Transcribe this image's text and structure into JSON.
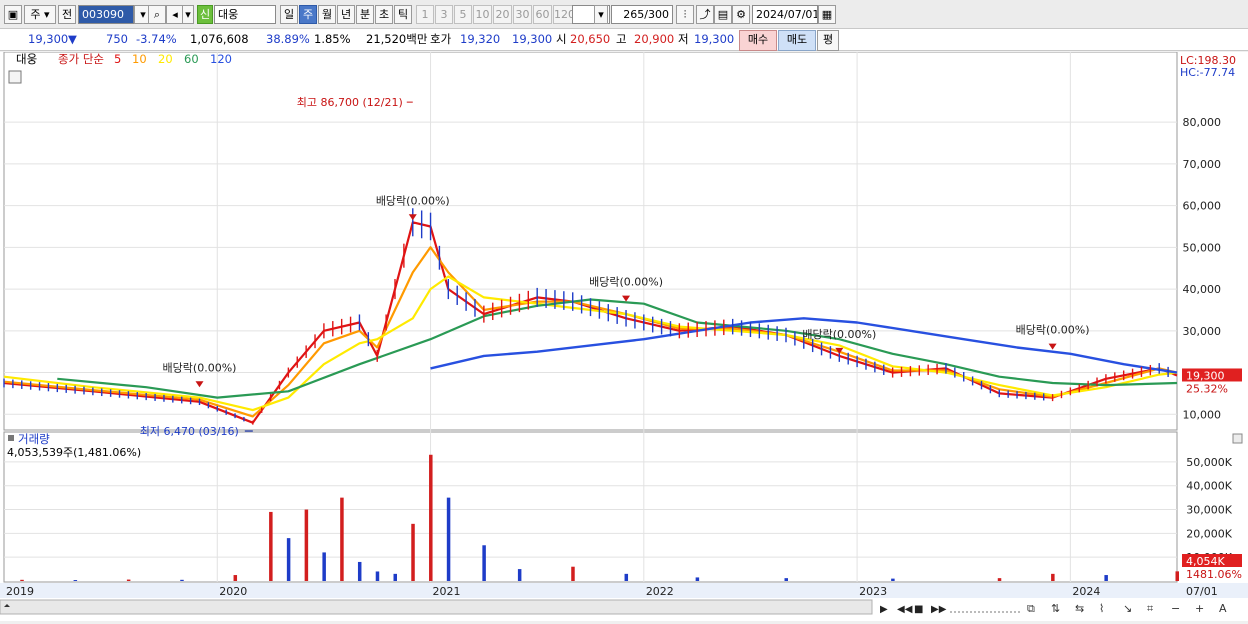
{
  "toolbar": {
    "market_label": "주",
    "prev_label": "전",
    "stock_code": "003090",
    "stock_badge": "신",
    "stock_name": "대웅",
    "period_labels": [
      "일",
      "주",
      "월",
      "년",
      "분",
      "초",
      "틱"
    ],
    "selected_period": "주",
    "interval_labels": [
      "1",
      "3",
      "5",
      "10",
      "20",
      "30",
      "60",
      "120"
    ],
    "count_value": "265",
    "count_total": "/300",
    "date_value": "2024/07/01"
  },
  "summary": {
    "price": "19,300",
    "change_arrow": "▼",
    "change": "750",
    "change_pct": "-3.74%",
    "volume": "1,076,608",
    "turnover_pct": "38.89%",
    "ratio_pct": "1.85%",
    "amount": "21,520백만",
    "quote_label": "호가",
    "quote_ask": "19,320",
    "quote_bid": "19,300",
    "open_label": "시",
    "open_value": "20,650",
    "high_label": "고",
    "high_value": "20,900",
    "low_label": "저",
    "low_value": "19,300",
    "buy_label": "매수",
    "sell_label": "매도",
    "eval_label": "평"
  },
  "chart_data": [
    {
      "type": "candlestick",
      "title": "대웅",
      "legend": {
        "label": "종가 단순",
        "periods": [
          "5",
          "10",
          "20",
          "60",
          "120"
        ]
      },
      "ylim": [
        6000,
        92000
      ],
      "y_ticks": [
        "10,000",
        "20,000",
        "30,000",
        "40,000",
        "50,000",
        "60,000",
        "70,000",
        "80,000"
      ],
      "y_tick_values": [
        10000,
        20000,
        30000,
        40000,
        50000,
        60000,
        70000,
        80000
      ],
      "x_ticks": [
        "2019",
        "2020",
        "2021",
        "2022",
        "2023",
        "2024",
        "07/01"
      ],
      "x_tick_dates": [
        "2019-01",
        "2020-01",
        "2021-01",
        "2022-01",
        "2023-01",
        "2024-01",
        "2024-07"
      ],
      "x_range": [
        "2019-01",
        "2024-07"
      ],
      "lc_label": "LC:198.30",
      "hc_label": "HC:-77.74",
      "last_price": 19300,
      "last_price_label": "19,300",
      "last_pct_label": "25.32%",
      "series": [
        {
          "name": "5",
          "color": "#e01414",
          "x": [
            "2019-01",
            "2019-06",
            "2019-12",
            "2020-03",
            "2020-05",
            "2020-07",
            "2020-09",
            "2020-10",
            "2020-12",
            "2021-01",
            "2021-02",
            "2021-04",
            "2021-07",
            "2021-09",
            "2021-12",
            "2022-03",
            "2022-06",
            "2022-09",
            "2022-12",
            "2023-03",
            "2023-06",
            "2023-09",
            "2023-12",
            "2024-03",
            "2024-06",
            "2024-07"
          ],
          "values": [
            17500,
            15500,
            13000,
            8000,
            20000,
            30000,
            32000,
            24000,
            56000,
            55000,
            40000,
            34000,
            38000,
            37000,
            33000,
            30000,
            31000,
            29000,
            24000,
            20000,
            21000,
            15000,
            14000,
            18500,
            21000,
            19300
          ]
        },
        {
          "name": "10",
          "color": "#ff9a00",
          "x": [
            "2019-01",
            "2019-06",
            "2019-12",
            "2020-03",
            "2020-05",
            "2020-07",
            "2020-09",
            "2020-10",
            "2020-12",
            "2021-01",
            "2021-02",
            "2021-04",
            "2021-07",
            "2021-09",
            "2021-12",
            "2022-03",
            "2022-06",
            "2022-09",
            "2022-12",
            "2023-03",
            "2023-06",
            "2023-09",
            "2023-12",
            "2024-03",
            "2024-06",
            "2024-07"
          ],
          "values": [
            17800,
            15800,
            13500,
            9500,
            17000,
            27000,
            30000,
            26000,
            44000,
            50000,
            44000,
            35000,
            37000,
            37000,
            34000,
            30500,
            30500,
            29000,
            25000,
            20500,
            20500,
            16000,
            14200,
            17500,
            21000,
            20000
          ]
        },
        {
          "name": "20",
          "color": "#ffea00",
          "x": [
            "2019-01",
            "2019-06",
            "2019-12",
            "2020-03",
            "2020-05",
            "2020-07",
            "2020-09",
            "2020-10",
            "2020-12",
            "2021-01",
            "2021-02",
            "2021-04",
            "2021-07",
            "2021-09",
            "2021-12",
            "2022-03",
            "2022-06",
            "2022-09",
            "2022-12",
            "2023-03",
            "2023-06",
            "2023-09",
            "2023-12",
            "2024-03",
            "2024-06",
            "2024-07"
          ],
          "values": [
            19000,
            16500,
            14000,
            11000,
            14000,
            22000,
            27000,
            28000,
            33000,
            40000,
            43000,
            38000,
            36500,
            35500,
            34000,
            31000,
            30000,
            29000,
            26500,
            21500,
            20000,
            17000,
            14500,
            16500,
            19500,
            20000
          ]
        },
        {
          "name": "60",
          "color": "#2a9a55",
          "x": [
            "2019-04",
            "2019-09",
            "2020-01",
            "2020-05",
            "2020-09",
            "2021-01",
            "2021-04",
            "2021-07",
            "2021-10",
            "2022-01",
            "2022-04",
            "2022-09",
            "2022-12",
            "2023-03",
            "2023-06",
            "2023-09",
            "2023-12",
            "2024-03",
            "2024-07"
          ],
          "values": [
            18500,
            16500,
            14000,
            15500,
            22000,
            28000,
            33500,
            36000,
            37500,
            36500,
            32000,
            30000,
            28000,
            24500,
            22000,
            19000,
            17500,
            17000,
            17500
          ]
        },
        {
          "name": "120",
          "color": "#2850e0",
          "x": [
            "2021-01",
            "2021-04",
            "2021-07",
            "2021-10",
            "2022-01",
            "2022-04",
            "2022-07",
            "2022-10",
            "2023-01",
            "2023-04",
            "2023-07",
            "2023-10",
            "2024-01",
            "2024-04",
            "2024-07"
          ],
          "values": [
            21000,
            24000,
            25000,
            26500,
            28000,
            30000,
            32000,
            33000,
            32000,
            30000,
            28000,
            26000,
            24500,
            22000,
            20000
          ]
        }
      ],
      "annotations": [
        {
          "text": "최고 86,700 (12/21)",
          "x": "2020-12",
          "y": 86700,
          "color": "#c81414"
        },
        {
          "text": "최저 6,470 (03/16)",
          "x": "2020-03",
          "y": 6470,
          "color": "#1e3cc8"
        },
        {
          "text": "배당락(0.00%)",
          "x": "2019-12",
          "y": 16000
        },
        {
          "text": "배당락(0.00%)",
          "x": "2020-12",
          "y": 56000
        },
        {
          "text": "배당락(0.00%)",
          "x": "2021-12",
          "y": 36500
        },
        {
          "text": "배당락(0.00%)",
          "x": "2022-12",
          "y": 24000
        },
        {
          "text": "배당락(0.00%)",
          "x": "2023-12",
          "y": 25000
        }
      ]
    },
    {
      "type": "bar",
      "title": "거래량",
      "summary_label": "4,053,539주(1,481.06%)",
      "unit": "주",
      "ylim": [
        0,
        55000
      ],
      "y_ticks": [
        "10,000K",
        "20,000K",
        "30,000K",
        "40,000K",
        "50,000K"
      ],
      "y_tick_values": [
        10000,
        20000,
        30000,
        40000,
        50000
      ],
      "last_label": "4,054K",
      "last_pct_label": "1481.06%",
      "x": [
        "2019-02",
        "2019-05",
        "2019-08",
        "2019-11",
        "2020-02",
        "2020-04",
        "2020-05",
        "2020-06",
        "2020-07",
        "2020-08",
        "2020-09",
        "2020-10",
        "2020-11",
        "2020-12",
        "2021-01",
        "2021-02",
        "2021-04",
        "2021-06",
        "2021-09",
        "2021-12",
        "2022-04",
        "2022-09",
        "2023-03",
        "2023-09",
        "2023-12",
        "2024-03",
        "2024-07"
      ],
      "values": [
        500,
        400,
        600,
        500,
        2500,
        29000,
        18000,
        30000,
        12000,
        35000,
        8000,
        4000,
        3000,
        24000,
        53000,
        35000,
        15000,
        5000,
        6000,
        3000,
        1500,
        1200,
        1000,
        1200,
        3000,
        2500,
        4054
      ]
    }
  ]
}
